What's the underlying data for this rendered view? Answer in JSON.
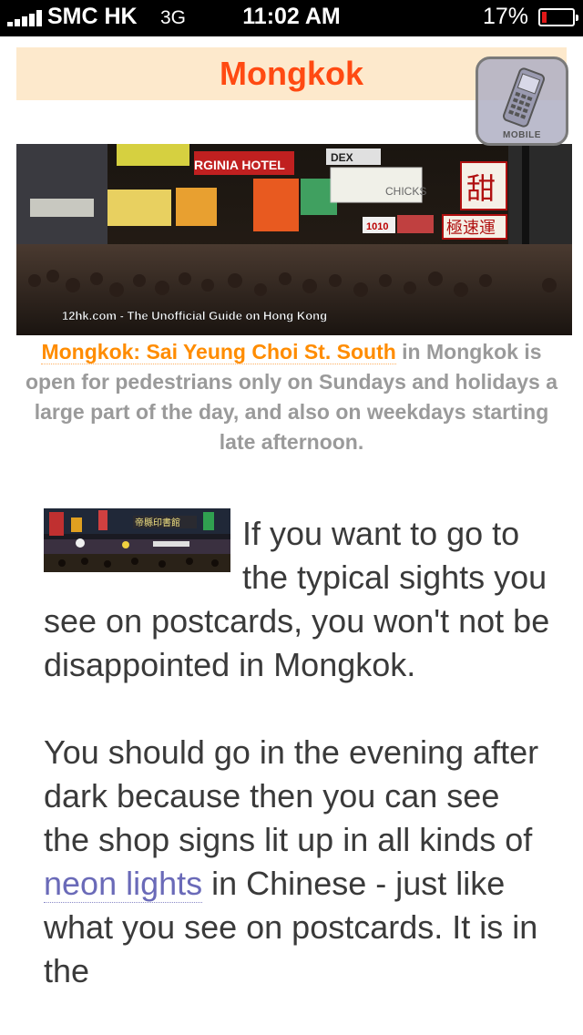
{
  "status_bar": {
    "carrier": "SMC HK",
    "network": "3G",
    "time": "11:02 AM",
    "battery_percent_text": "17%",
    "battery_level": 0.17
  },
  "page": {
    "title": "Mongkok",
    "mobile_button": {
      "label": "MOBILE",
      "icon": "mobile-phone-icon"
    },
    "hero_image": {
      "credit": "12hk.com - The Unofficial Guide on Hong Kong",
      "signs": [
        "RGINIA HOTEL",
        "CHICKS",
        "1010",
        "甜",
        "極速運",
        "DEX"
      ]
    },
    "caption": {
      "link": "Mongkok: Sai Yeung Choi St. South",
      "rest": " in Mongkok is open for pedestrians only on Sundays and holidays a large part of the day, and also on weekdays starting late afternoon."
    },
    "paragraphs": [
      {
        "text": "If you want to go to the typical sights you see on postcards, you won't not be disappointed in Mongkok."
      },
      {
        "before": "You should go in the evening after dark because then you can see the shop signs lit up in all kinds of ",
        "link": "neon lights",
        "after": " in Chinese - just like what you see on postcards. It is in the"
      }
    ],
    "thumbnail": {
      "sign": "帝縣印書館"
    },
    "colors": {
      "title": "#ff4a12",
      "title_bg": "#fde9cc",
      "caption_link": "#ff8c00",
      "body_link": "#6a6ab8",
      "body_text": "#3a3a3a"
    }
  }
}
